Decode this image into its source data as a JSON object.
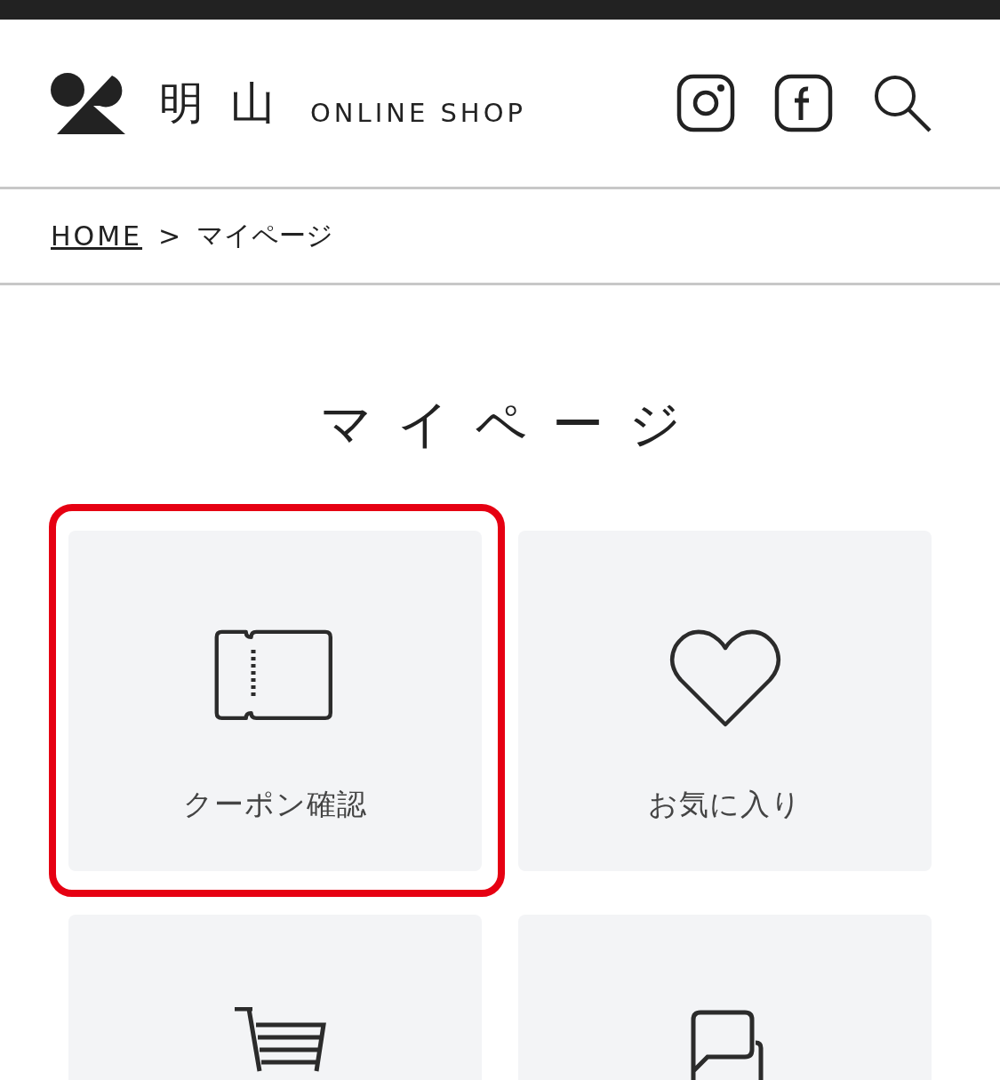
{
  "header": {
    "brand": "明山",
    "tagline": "ONLINE SHOP"
  },
  "breadcrumb": [
    {
      "label": "HOME",
      "kind": "link"
    },
    {
      "label": ">",
      "kind": "separator"
    },
    {
      "label": "マイページ",
      "kind": "current"
    }
  ],
  "title": "マイページ",
  "tiles": [
    {
      "kind": "coupon",
      "label": "クーポン確認",
      "highlighted": true
    },
    {
      "kind": "heart",
      "label": "お気に入り",
      "highlighted": false
    },
    {
      "kind": "cart",
      "highlighted": false
    },
    {
      "kind": "chat",
      "highlighted": false
    }
  ]
}
